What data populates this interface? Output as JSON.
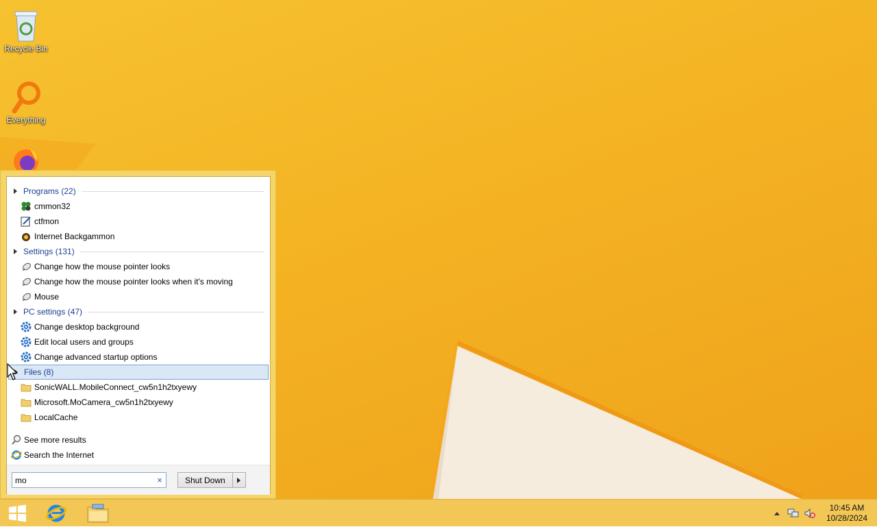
{
  "desktop": {
    "icons": [
      {
        "label": "Recycle Bin",
        "icon": "recycle-bin-icon"
      },
      {
        "label": "Everything",
        "icon": "everything-search-icon"
      },
      {
        "label": "",
        "icon": "firefox-icon"
      }
    ]
  },
  "start_menu": {
    "groups": [
      {
        "title": "Programs (22)",
        "items": [
          {
            "label": "cmmon32",
            "icon": "cmmon32-icon"
          },
          {
            "label": "ctfmon",
            "icon": "ctfmon-icon"
          },
          {
            "label": "Internet Backgammon",
            "icon": "backgammon-icon"
          }
        ]
      },
      {
        "title": "Settings (131)",
        "items": [
          {
            "label": "Change how the mouse pointer looks",
            "icon": "mouse-icon"
          },
          {
            "label": "Change how the mouse pointer looks when it's moving",
            "icon": "mouse-icon"
          },
          {
            "label": "Mouse",
            "icon": "mouse-icon"
          }
        ]
      },
      {
        "title": "PC settings (47)",
        "items": [
          {
            "label": "Change desktop background",
            "icon": "gear-icon"
          },
          {
            "label": "Edit local users and groups",
            "icon": "gear-icon"
          },
          {
            "label": "Change advanced startup options",
            "icon": "gear-icon"
          }
        ]
      },
      {
        "title": "Files (8)",
        "items": [
          {
            "label": "SonicWALL.MobileConnect_cw5n1h2txyewy",
            "icon": "folder-icon"
          },
          {
            "label": "Microsoft.MoCamera_cw5n1h2txyewy",
            "icon": "folder-icon"
          },
          {
            "label": "LocalCache",
            "icon": "folder-icon"
          }
        ]
      }
    ],
    "see_more": "See more results",
    "search_internet": "Search the Internet",
    "search_value": "mo",
    "clear_symbol": "×",
    "shutdown_label": "Shut Down"
  },
  "taskbar": {
    "time": "10:45 AM",
    "date": "10/28/2024"
  },
  "colors": {
    "group_title": "#1c3f94",
    "wallpaper": "#f4b323",
    "taskbar": "#f3c756",
    "menu_frame": "#f5d56a"
  }
}
